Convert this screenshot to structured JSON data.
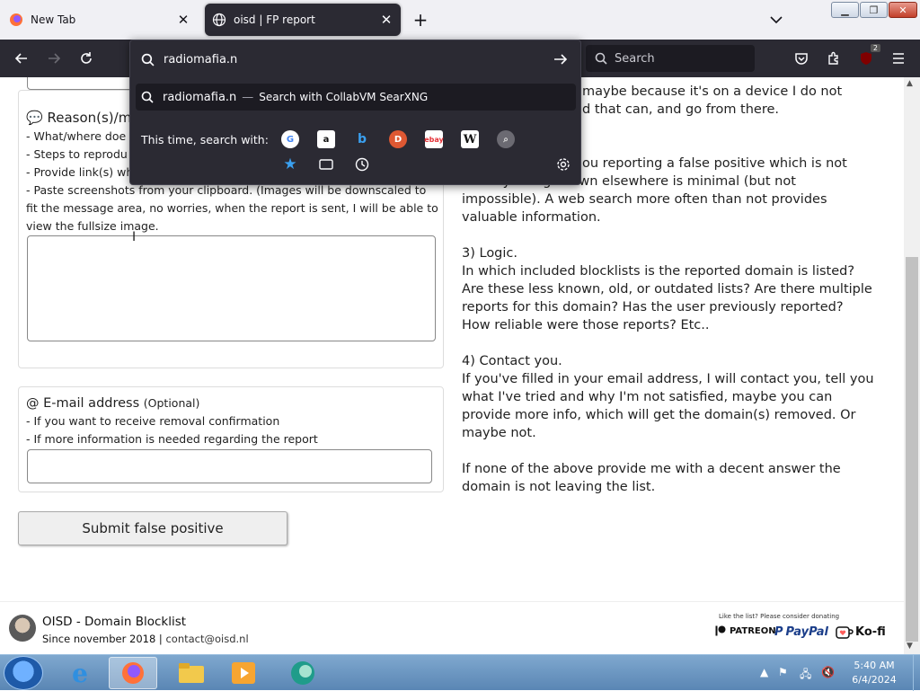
{
  "browser": {
    "tabs": [
      {
        "label": "New Tab",
        "icon": "firefox-icon"
      },
      {
        "label": "oisd | FP report",
        "icon": "globe-icon"
      }
    ],
    "urlbar": {
      "value": "radiomafia.n",
      "suggestion_text": "radiomafia.n",
      "suggestion_separator": "—",
      "suggestion_sub": "Search with CollabVM SearXNG",
      "oneoff_label": "This time, search with:"
    },
    "search_placeholder": "Search",
    "badge_count": "2"
  },
  "form": {
    "reason_title": "Reason(s)/m",
    "reason_lines": [
      "- What/where doe",
      "- Steps to reprodu",
      "- Provide link(s) wh",
      "- Paste screenshots from your clipboard. (Images will be downscaled to",
      "fit the message area, no worries, when the report is sent, I will be able to",
      "view the fullsize image."
    ],
    "email_title": "@ E-mail address",
    "email_optional": "(Optional)",
    "email_lines": [
      "- If you want to receive removal confirmation",
      "- If more information is needed regarding the report"
    ],
    "submit_label": "Submit false positive"
  },
  "info": {
    "lines_top": [
      "maybe because it's on a device I do not",
      "d that can, and go from there."
    ],
    "p2_fragment": "ou reporting a false positive which is not",
    "p2_lines": [
      "already being known elsewhere is minimal (but not",
      "impossible). A web search more often than not provides",
      "valuable information."
    ],
    "p3_title": "3) Logic.",
    "p3_lines": [
      "In which included blocklists is the reported domain is listed?",
      "Are these less known, old, or outdated lists? Are there multiple",
      "reports for this domain? Has the user previously reported?",
      "How reliable were those reports? Etc.."
    ],
    "p4_title": "4) Contact you.",
    "p4_lines": [
      "If you've filled in your email address, I will contact you, tell you",
      "what I've tried and why I'm not satisfied, maybe you can",
      "provide more info, which will get the domain(s) removed. Or",
      "maybe not."
    ],
    "p5_lines": [
      "If none of the above provide me with a decent answer the",
      "domain is not leaving the list."
    ]
  },
  "footer": {
    "title": "OISD - Domain Blocklist",
    "since": "Since november 2018 |",
    "contact": "contact@oisd.nl",
    "donate_note": "Like the list? Please consider donating",
    "patreon": "PATREON",
    "paypal": "PayPal",
    "kofi": "Ko-fi"
  },
  "taskbar": {
    "time": "5:40 AM",
    "date": "6/4/2024"
  }
}
